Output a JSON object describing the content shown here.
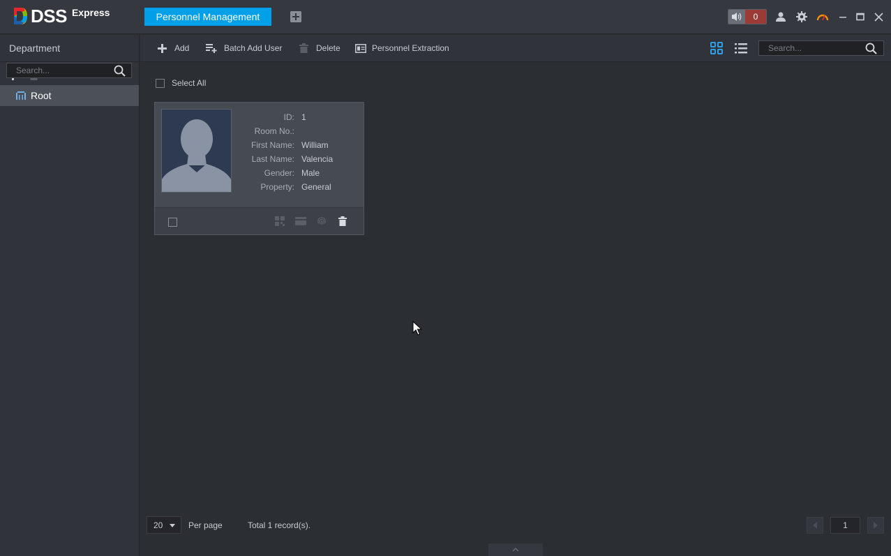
{
  "app": {
    "logo_text": "DSS",
    "logo_suffix": "Express",
    "active_tab": "Personnel Management",
    "alarm_count": "0"
  },
  "sidebar": {
    "title": "Department",
    "search_placeholder": "Search...",
    "tree": [
      {
        "label": "Root",
        "selected": true
      }
    ]
  },
  "toolbar": {
    "add_label": "Add",
    "batch_add_label": "Batch Add User",
    "delete_label": "Delete",
    "extraction_label": "Personnel Extraction",
    "search_placeholder": "Search...",
    "view_mode": "grid"
  },
  "list": {
    "select_all_label": "Select All",
    "cards": [
      {
        "fields": [
          {
            "label": "ID:",
            "value": "1"
          },
          {
            "label": "Room No.:",
            "value": ""
          },
          {
            "label": "First Name:",
            "value": "William"
          },
          {
            "label": "Last Name:",
            "value": "Valencia"
          },
          {
            "label": "Gender:",
            "value": "Male"
          },
          {
            "label": "Property:",
            "value": "General"
          }
        ]
      }
    ]
  },
  "footer": {
    "per_page_value": "20",
    "per_page_label": "Per page",
    "total_label": "Total 1 record(s).",
    "current_page": "1"
  },
  "colors": {
    "accent": "#00a0e9",
    "alarm_red": "#9c3b36",
    "background": "#2b2e33",
    "panel": "#30333a",
    "selected": "#4b5059"
  }
}
